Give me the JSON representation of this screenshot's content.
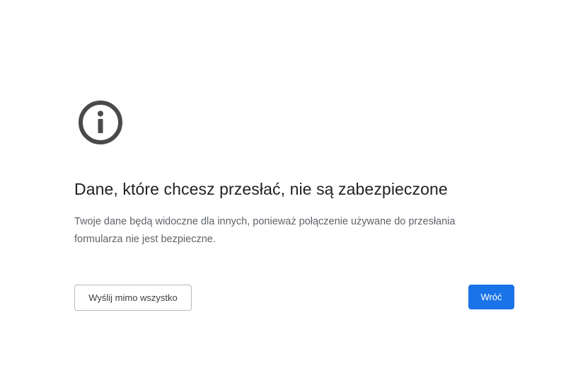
{
  "icon": "info-icon",
  "heading": "Dane, które chcesz przesłać, nie są zabezpieczone",
  "message": "Twoje dane będą widoczne dla innych, ponieważ połączenie używane do przesłania formularza nie jest bezpieczne.",
  "buttons": {
    "send_anyway_label": "Wyślij mimo wszystko",
    "back_label": "Wróć"
  },
  "colors": {
    "primary_button": "#1a73e8",
    "heading_text": "#202124",
    "body_text": "#5f6368",
    "icon": "#4a4a4a"
  }
}
